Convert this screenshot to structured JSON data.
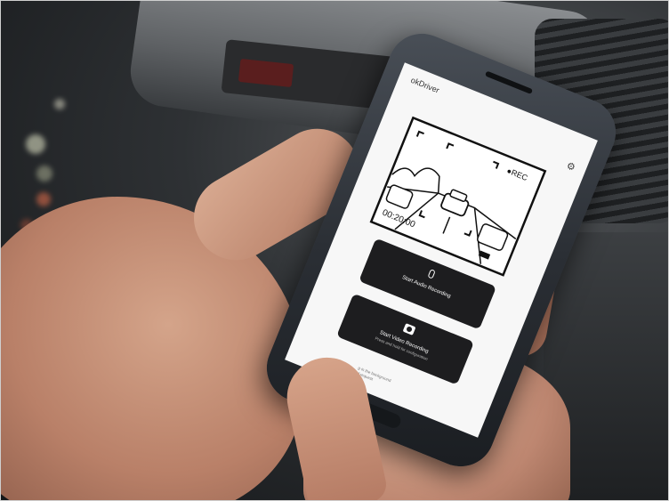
{
  "app": {
    "title": "okDriver",
    "settings_icon": "gear-icon"
  },
  "dashcam_overlay": {
    "rec_label": "●REC",
    "timestamp": "00:20:00"
  },
  "buttons": {
    "audio": {
      "icon": "microphone-icon",
      "label": "Start Audio Recording"
    },
    "video": {
      "icon": "camera-icon",
      "label": "Start Video Recording",
      "sublabel": "Press and hold for configuration"
    }
  },
  "footer": {
    "line1": "g in the background",
    "line2": "of request"
  }
}
